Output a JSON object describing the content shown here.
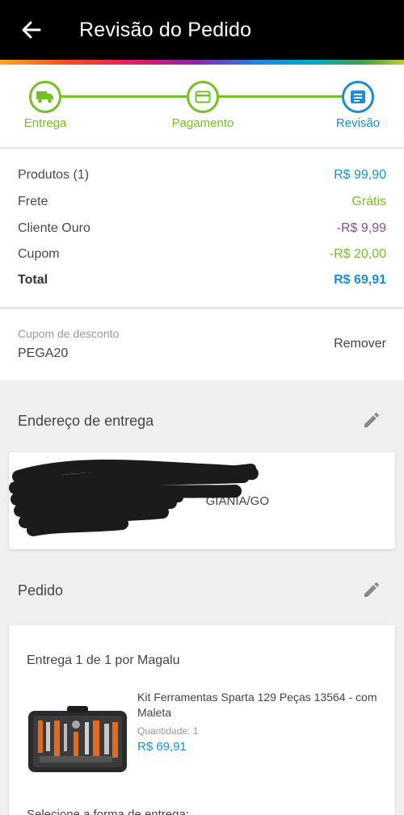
{
  "header": {
    "title": "Revisão do Pedido"
  },
  "stepper": {
    "steps": [
      {
        "label": "Entrega"
      },
      {
        "label": "Pagamento"
      },
      {
        "label": "Revisão"
      }
    ]
  },
  "summary": {
    "rows": [
      {
        "label": "Produtos (1)",
        "value": "R$ 99,90",
        "color": "#1a8fd6"
      },
      {
        "label": "Frete",
        "value": "Grátis",
        "color": "#75c025"
      },
      {
        "label": "Cliente Ouro",
        "value": "-R$ 9,99",
        "color": "#8e4a9e"
      },
      {
        "label": "Cupom",
        "value": "-R$ 20,00",
        "color": "#75c025"
      }
    ],
    "total": {
      "label": "Total",
      "value": "R$ 69,91"
    }
  },
  "coupon": {
    "caption": "Cupom de desconto",
    "code": "PEGA20",
    "remove_label": "Remover"
  },
  "address": {
    "title": "Endereço de entrega",
    "visible_text": "GIANIA/GO"
  },
  "order": {
    "title": "Pedido",
    "delivery_title": "Entrega 1 de 1 por Magalu",
    "product": {
      "name": "Kit Ferramentas Sparta 129 Peças 13564 - com Maleta",
      "quantity_label": "Quantidade:",
      "quantity": "1",
      "price": "R$ 69,91"
    },
    "next_section": "Selecione a forma de entrega:"
  },
  "colors": {
    "accent_green": "#75c025",
    "accent_blue": "#1a8fd6",
    "purple": "#8e4a9e"
  }
}
